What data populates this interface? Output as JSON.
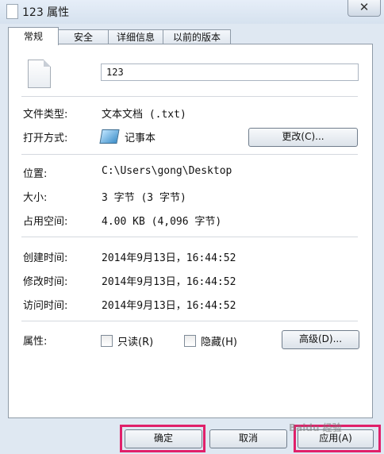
{
  "window": {
    "title": "123 属性",
    "close_glyph": "✕"
  },
  "tabs": [
    {
      "label": "常规",
      "active": true
    },
    {
      "label": "安全",
      "active": false
    },
    {
      "label": "详细信息",
      "active": false
    },
    {
      "label": "以前的版本",
      "active": false
    }
  ],
  "general": {
    "file_name": "123",
    "file_type_label": "文件类型:",
    "file_type_value": "文本文档 (.txt)",
    "open_with_label": "打开方式:",
    "open_with_value": "记事本",
    "change_button": "更改(C)...",
    "location_label": "位置:",
    "location_value": "C:\\Users\\gong\\Desktop",
    "size_label": "大小:",
    "size_value": "3 字节 (3 字节)",
    "size_on_disk_label": "占用空间:",
    "size_on_disk_value": "4.00 KB (4,096 字节)",
    "created_label": "创建时间:",
    "created_value": "2014年9月13日，16:44:52",
    "modified_label": "修改时间:",
    "modified_value": "2014年9月13日，16:44:52",
    "accessed_label": "访问时间:",
    "accessed_value": "2014年9月13日，16:44:52",
    "attributes_label": "属性:",
    "readonly_label": "只读(R)",
    "readonly_checked": false,
    "hidden_label": "隐藏(H)",
    "hidden_checked": false,
    "advanced_button": "高级(D)..."
  },
  "footer": {
    "ok_button": "确定",
    "cancel_button": "取消",
    "apply_button": "应用(A)"
  },
  "highlight_color": "#e0206a",
  "watermark": "Baidu 经验"
}
